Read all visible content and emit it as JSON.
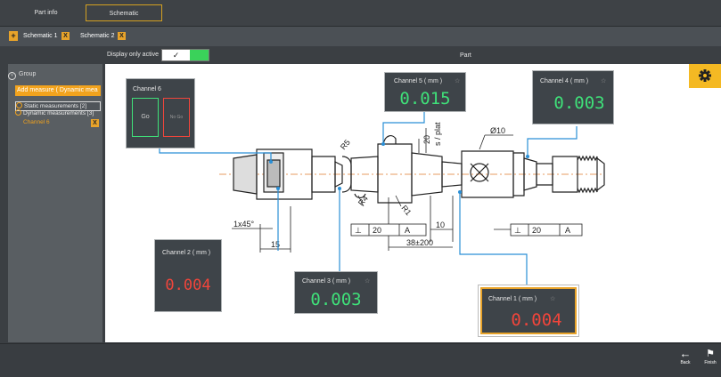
{
  "top_tabs": {
    "part_info": "Part info",
    "schematic": "Schematic"
  },
  "schematic_tabs": [
    {
      "label": "Schematic 1",
      "close": "X"
    },
    {
      "label": "Schematic 2",
      "close": "X"
    }
  ],
  "add_schematic": "+",
  "display_only_active": {
    "label": "Display only active",
    "check": "✓"
  },
  "part_label": "Part",
  "sidebar": {
    "group": "Group",
    "add_measure": "Add measure  ( Dynamic mea",
    "static": "Static measurements [2]",
    "dynamic": "Dynamic measurements [3]",
    "channel6": "Channel 6",
    "channel6_close": "X"
  },
  "drawing": {
    "r5": "R5",
    "r4": "R4",
    "r1": "R1",
    "dim20": "20",
    "splat": "s / plat",
    "phi10": "Ø10",
    "chamfer": "1x45°",
    "dim15": "15",
    "dim10": "10",
    "dim38": "38±200",
    "tol1_val": "20",
    "tol1_ref": "A",
    "tol2_val": "20",
    "tol2_ref": "A"
  },
  "channel6": {
    "title": "Channel 6",
    "go": "Go",
    "nogo": "No Go"
  },
  "channel5": {
    "title": "Channel 5 ( mm )",
    "value": "0.015"
  },
  "channel4": {
    "title": "Channel 4 ( mm )",
    "value": "0.003"
  },
  "channel2": {
    "title": "Channel 2 ( mm )",
    "value": "0.004"
  },
  "channel3": {
    "title": "Channel 3 ( mm )",
    "value": "0.003"
  },
  "channel1": {
    "title": "Channel 1 ( mm )",
    "value": "0.004"
  },
  "footer": {
    "back": "Back",
    "finish": "Finish"
  },
  "colors": {
    "accent": "#f2a31d",
    "ok": "#3fe079",
    "nok": "#f1453b",
    "panel": "#3e4449",
    "line": "#2a8fd6"
  }
}
